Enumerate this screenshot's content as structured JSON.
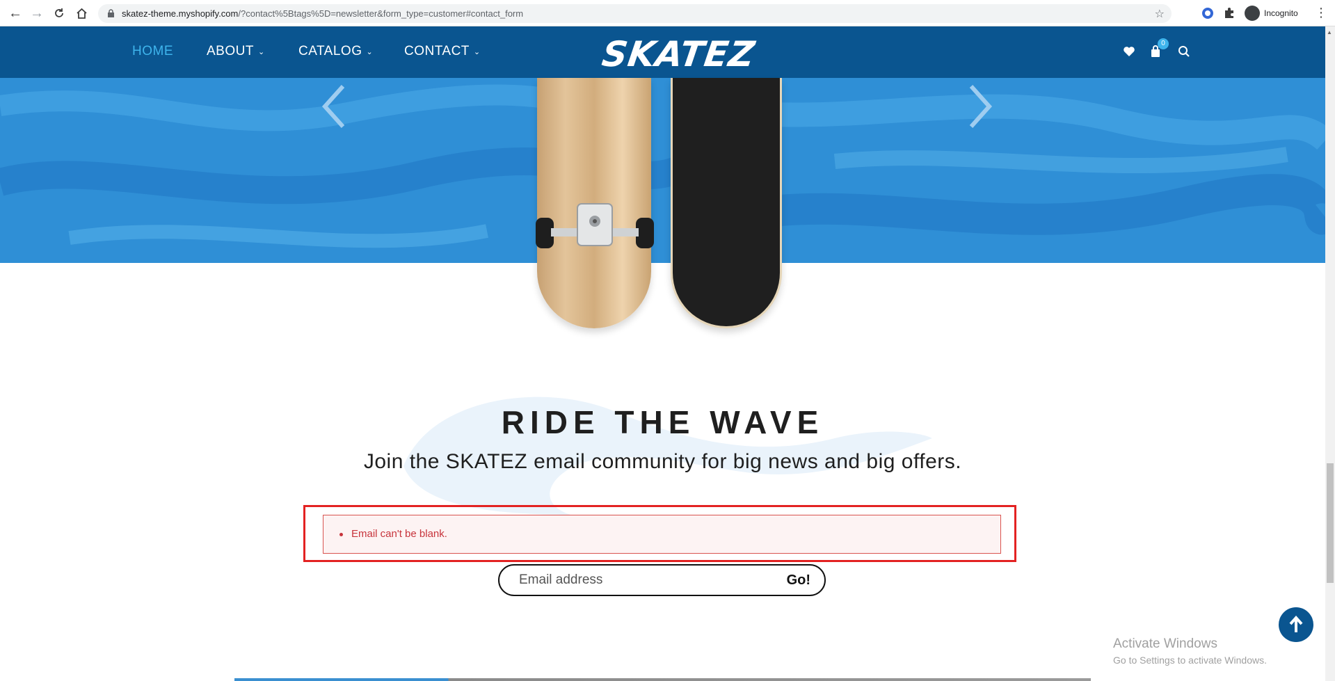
{
  "browser": {
    "url_host": "skatez-theme.myshopify.com",
    "url_rest": "/?contact%5Btags%5D=newsletter&form_type=customer#contact_form",
    "profile_label": "Incognito"
  },
  "header": {
    "nav": [
      {
        "label": "HOME"
      },
      {
        "label": "ABOUT"
      },
      {
        "label": "CATALOG"
      },
      {
        "label": "CONTACT"
      }
    ],
    "logo": "SKATEZ",
    "cart_count": "0"
  },
  "newsletter": {
    "title": "RIDE THE WAVE",
    "subtitle": "Join the SKATEZ email community for big news and big offers.",
    "error": "Email can't be blank.",
    "email_placeholder": "Email address",
    "submit_label": "Go!"
  },
  "watermark": {
    "line1": "Activate Windows",
    "line2": "Go to Settings to activate Windows."
  },
  "colors": {
    "header_bg": "#0a5590",
    "active_nav": "#3eb4ec",
    "error_text": "#c7333b",
    "highlight_border": "#e32222"
  }
}
